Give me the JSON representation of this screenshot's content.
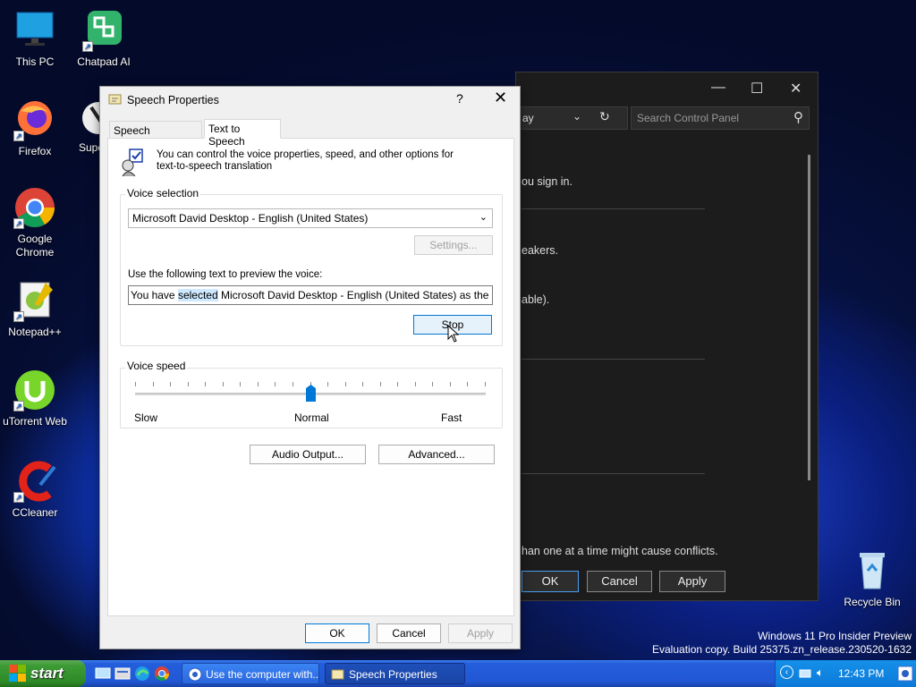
{
  "desktop": {
    "icons": [
      {
        "label": "This PC"
      },
      {
        "label": "Chatpad AI"
      },
      {
        "label": "Firefox"
      },
      {
        "label": "Supe"
      },
      {
        "label": "Google Chrome"
      },
      {
        "label": "Notepad++"
      },
      {
        "label": "uTorrent Web"
      },
      {
        "label": "CCleaner"
      },
      {
        "label": "Recycle Bin"
      }
    ],
    "watermark_line1": "Windows 11 Pro Insider Preview",
    "watermark_line2": "Evaluation copy. Build 25375.zn_release.230520-1632"
  },
  "control_panel": {
    "address_fragment": "ay",
    "search_placeholder": "Search Control Panel",
    "lines": [
      "ou sign in.",
      "eakers.",
      "able).",
      "han one at a time might cause conflicts."
    ],
    "buttons": {
      "ok": "OK",
      "cancel": "Cancel",
      "apply": "Apply"
    }
  },
  "dialog": {
    "title": "Speech Properties",
    "help": "?",
    "close": "✕",
    "tabs": [
      "Speech Recognition",
      "Text to Speech"
    ],
    "intro_line1": "You can control the voice properties, speed, and other options for",
    "intro_line2": "text-to-speech translation",
    "voice_selection": {
      "label": "Voice selection",
      "selected": "Microsoft David Desktop - English (United States)",
      "settings_label": "Settings..."
    },
    "preview": {
      "label": "Use the following text to preview the voice:",
      "text_before": "You have ",
      "text_highlight": "selected",
      "text_after": " Microsoft David Desktop - English (United States) as the computer",
      "stop_label": "Stop"
    },
    "voice_speed": {
      "label": "Voice speed",
      "slow": "Slow",
      "normal": "Normal",
      "fast": "Fast",
      "value": 0.5
    },
    "audio_output_label": "Audio Output...",
    "advanced_label": "Advanced...",
    "buttons": {
      "ok": "OK",
      "cancel": "Cancel",
      "apply": "Apply"
    }
  },
  "taskbar": {
    "start_label": "start",
    "tasks": [
      "Use the computer with...",
      "Speech Properties"
    ],
    "clock": "12:43 PM"
  }
}
